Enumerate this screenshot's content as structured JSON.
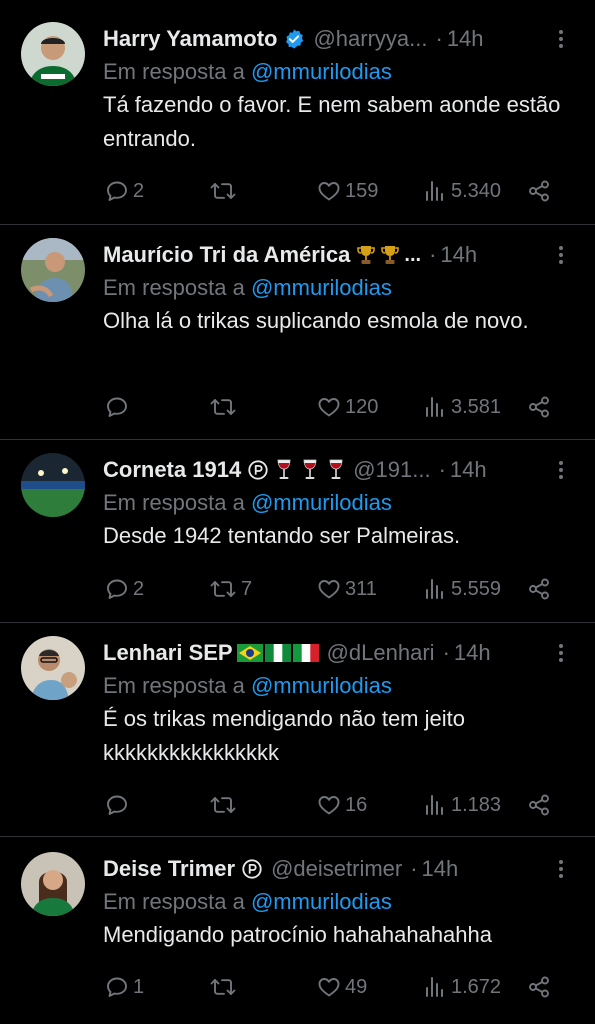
{
  "tweets": [
    {
      "name": "Harry Yamamoto",
      "handle": "@harryya...",
      "time": "14h",
      "reply_prefix": "Em resposta a",
      "reply_to": "@mmurilodias",
      "text": "Tá fazendo o favor. E nem sabem aonde estão entrando.",
      "replies": "2",
      "retweets": "",
      "likes": "159",
      "views": "5.340",
      "verified": true
    },
    {
      "name": "Maurício Tri da América",
      "handle": "",
      "time": "14h",
      "reply_prefix": "Em resposta a",
      "reply_to": "@mmurilodias",
      "text": "Olha lá o trikas suplicando esmola de novo.",
      "replies": "",
      "retweets": "",
      "likes": "120",
      "views": "3.581",
      "name_suffix": "🏆🏆..."
    },
    {
      "name": "Corneta 1914",
      "handle": "@191...",
      "time": "14h",
      "reply_prefix": "Em resposta a",
      "reply_to": "@mmurilodias",
      "text": "Desde 1942 tentando ser Palmeiras.",
      "replies": "2",
      "retweets": "7",
      "likes": "311",
      "views": "5.559"
    },
    {
      "name": "Lenhari SEP",
      "handle": "@dLenhari",
      "time": "14h",
      "reply_prefix": "Em resposta a",
      "reply_to": "@mmurilodias",
      "text": "É os trikas mendigando não tem jeito kkkkkkkkkkkkkkkk",
      "replies": "",
      "retweets": "",
      "likes": "16",
      "views": "1.183"
    },
    {
      "name": "Deise Trimer",
      "handle": "@deisetrimer",
      "time": "14h",
      "reply_prefix": "Em resposta a",
      "reply_to": "@mmurilodias",
      "text": "Mendigando patrocínio hahahahahahha",
      "replies": "1",
      "retweets": "",
      "likes": "49",
      "views": "1.672"
    }
  ],
  "icons": {
    "reply": "reply-icon",
    "retweet": "retweet-icon",
    "like": "like-icon",
    "views": "views-icon",
    "share": "share-icon",
    "more": "more-icon",
    "verified": "verified-badge-icon",
    "paid": "paid-badge-icon"
  },
  "colors": {
    "background": "#000000",
    "text": "#e7e9ea",
    "muted": "#71767b",
    "link": "#1d9bf0",
    "divider": "#2f3336"
  }
}
